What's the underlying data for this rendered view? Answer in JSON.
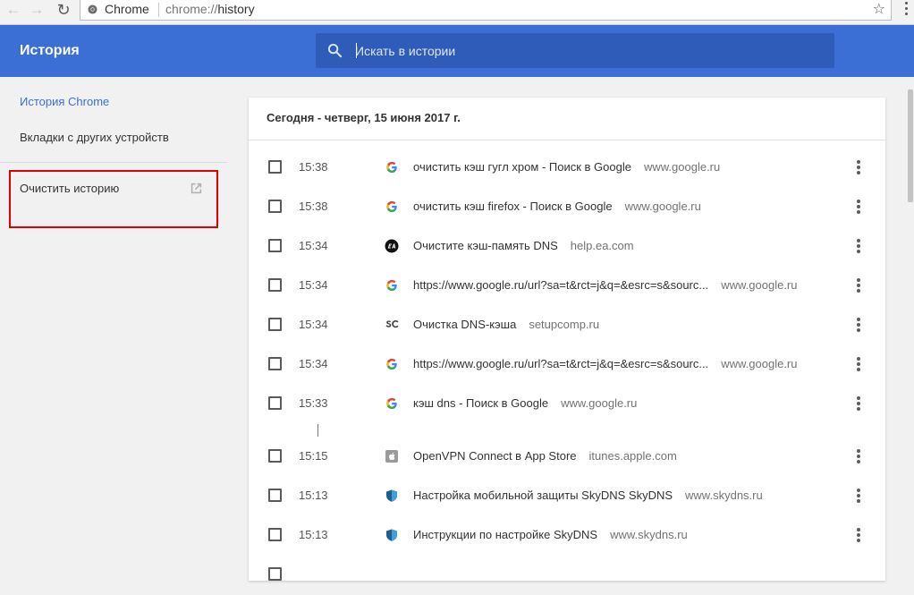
{
  "browser": {
    "nav_back": "←",
    "nav_forward": "→",
    "nav_reload": "↻",
    "chip_label": "Chrome",
    "url_scheme": "chrome://",
    "url_path": "history",
    "star": "☆"
  },
  "header": {
    "title": "История",
    "search_placeholder": "Искать в истории"
  },
  "sidebar": {
    "items": [
      {
        "label": "История Chrome"
      },
      {
        "label": "Вкладки с других устройств"
      },
      {
        "label": "Очистить историю"
      }
    ]
  },
  "history": {
    "date_heading": "Сегодня - четверг, 15 июня 2017 г.",
    "rows": [
      {
        "time": "15:38",
        "title": "очистить кэш гугл хром - Поиск в Google",
        "domain": "www.google.ru",
        "icon": "google-icon"
      },
      {
        "time": "15:38",
        "title": "очистить кэш firefox - Поиск в Google",
        "domain": "www.google.ru",
        "icon": "google-icon"
      },
      {
        "time": "15:34",
        "title": "Очистите кэш-память DNS",
        "domain": "help.ea.com",
        "icon": "ea-icon"
      },
      {
        "time": "15:34",
        "title": "https://www.google.ru/url?sa=t&rct=j&q=&esrc=s&sourc...",
        "domain": "www.google.ru",
        "icon": "google-icon"
      },
      {
        "time": "15:34",
        "title": "Очистка DNS-кэша",
        "domain": "setupcomp.ru",
        "icon": "sc-icon"
      },
      {
        "time": "15:34",
        "title": "https://www.google.ru/url?sa=t&rct=j&q=&esrc=s&sourc...",
        "domain": "www.google.ru",
        "icon": "google-icon"
      },
      {
        "time": "15:33",
        "title": "кэш dns - Поиск в Google",
        "domain": "www.google.ru",
        "icon": "google-icon"
      },
      {
        "time": "15:15",
        "title": "OpenVPN Connect в App Store",
        "domain": "itunes.apple.com",
        "icon": "apple-icon"
      },
      {
        "time": "15:13",
        "title": "Настройка мобильной защиты SkyDNS SkyDNS",
        "domain": "www.skydns.ru",
        "icon": "shield-icon"
      },
      {
        "time": "15:13",
        "title": "Инструкции по настройке SkyDNS",
        "domain": "www.skydns.ru",
        "icon": "shield-icon"
      }
    ]
  },
  "colors": {
    "header_blue": "#3b6fd6",
    "search_blue": "#2f5cb8",
    "link_blue": "#3b6fd6",
    "highlight_red": "#e00000"
  }
}
